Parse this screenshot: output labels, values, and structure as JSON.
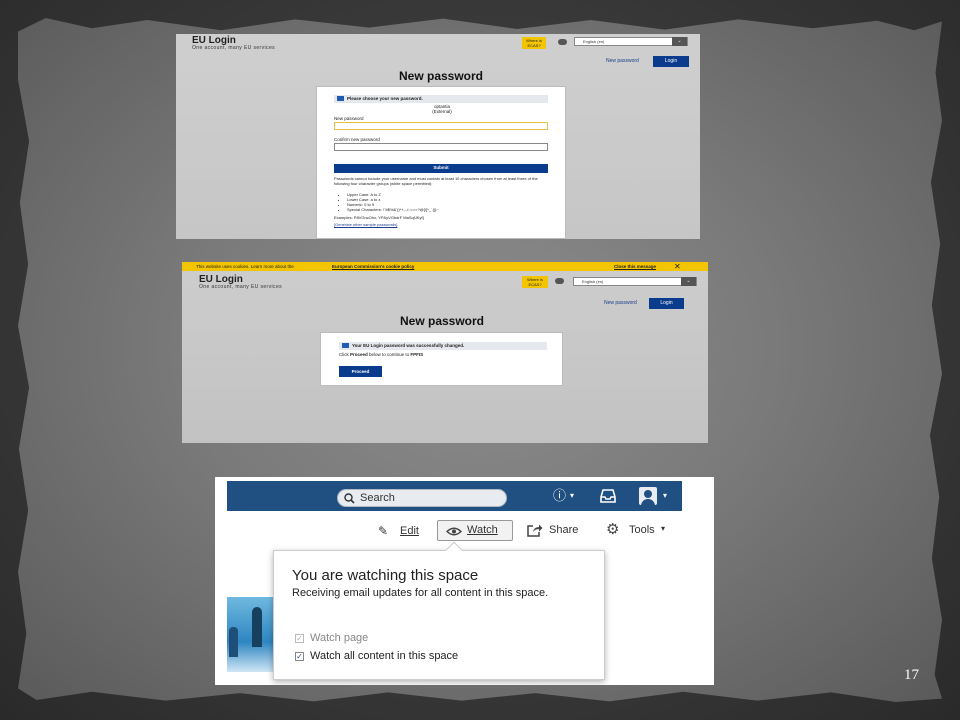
{
  "slide": {
    "page_number": "17"
  },
  "shot1": {
    "brand_title": "EU Login",
    "brand_subtitle": "One account, many EU services",
    "ecas_label": "Where is ECAS?",
    "language": "English (en)",
    "new_password_link": "New password",
    "login_button": "Login",
    "page_title": "New password",
    "message": "Please choose your new password.",
    "username": "optantia",
    "user_type": "(External)",
    "new_password_label": "New password",
    "confirm_label": "Confirm new password",
    "submit_button": "Submit",
    "rules_intro": "Passwords cannot include your username and must contain at least 10 characters chosen from at least three of the following four character groups (white space permitted):",
    "rules": [
      "Upper Case: A to Z",
      "Lower Case: a to z",
      "Numeric: 0 to 9",
      "Special Characters: !\"#$%&'()*+,-./:;<=>?@[\\]^_`{|}~"
    ],
    "examples": "Examples: P8VGncOhx, YP&yVGbdrF MaSqfJKyf]",
    "generate_link": "[Generate other sample passwords]"
  },
  "shot2": {
    "cookie_text": "This website uses cookies. Learn more about the",
    "cookie_link": "European Commission's cookie policy",
    "cookie_close": "Close this message",
    "brand_title": "EU Login",
    "brand_subtitle": "One account, many EU services",
    "ecas_label": "Where is ECAS?",
    "language": "English (en)",
    "new_password_link": "New password",
    "login_button": "Login",
    "page_title": "New password",
    "message": "Your EU Login password was successfully changed.",
    "continue_prefix": "Click",
    "continue_bold": "Proceed",
    "continue_suffix": "below to continue to",
    "continue_target": "FPFIS",
    "proceed_button": "Proceed"
  },
  "shot3": {
    "search_placeholder": "Search",
    "toolbar": {
      "edit_label": "Edit",
      "watch_label": "Watch",
      "share_label": "Share",
      "tools_label": "Tools"
    },
    "popup": {
      "title": "You are watching this space",
      "description": "Receiving email updates for all content in this space.",
      "watch_page_label": "Watch page",
      "watch_all_label": "Watch all content in this space"
    },
    "colors": {
      "topbar": "#205081"
    }
  }
}
